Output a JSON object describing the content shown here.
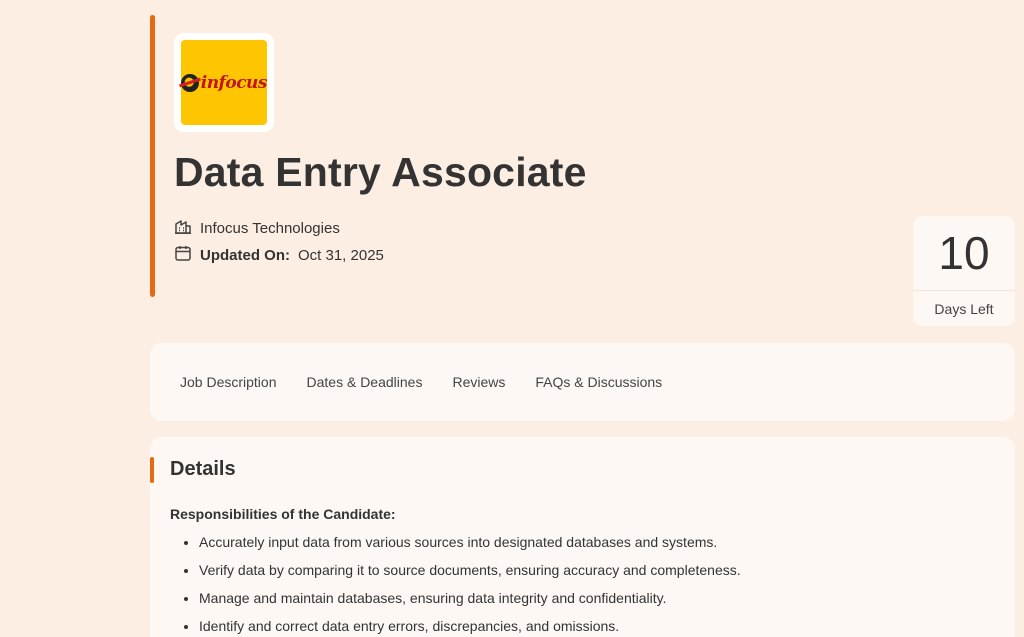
{
  "job": {
    "logo_text": "infocus",
    "title": "Data Entry Associate",
    "company": "Infocus Technologies",
    "updated_label": "Updated On:",
    "updated_date": "Oct 31, 2025",
    "days_left_value": "10",
    "days_left_label": "Days Left"
  },
  "tabs": [
    {
      "label": "Job Description"
    },
    {
      "label": "Dates & Deadlines"
    },
    {
      "label": "Reviews"
    },
    {
      "label": "FAQs & Discussions"
    }
  ],
  "details": {
    "title": "Details",
    "responsibilities_heading": "Responsibilities of the Candidate:",
    "responsibilities": [
      "Accurately input data from various sources into designated databases and systems.",
      "Verify data by comparing it to source documents, ensuring accuracy and completeness.",
      "Manage and maintain databases, ensuring data integrity and confidentiality.",
      "Identify and correct data entry errors, discrepancies, and omissions."
    ]
  },
  "colors": {
    "page_bg": "#fdeee3",
    "accent": "#e46a13",
    "card_bg": "#fdf8f4",
    "logo_bg": "#fec600",
    "logo_text": "#c1141b"
  },
  "icons": {
    "company": "building-icon",
    "updated": "calendar-icon"
  }
}
